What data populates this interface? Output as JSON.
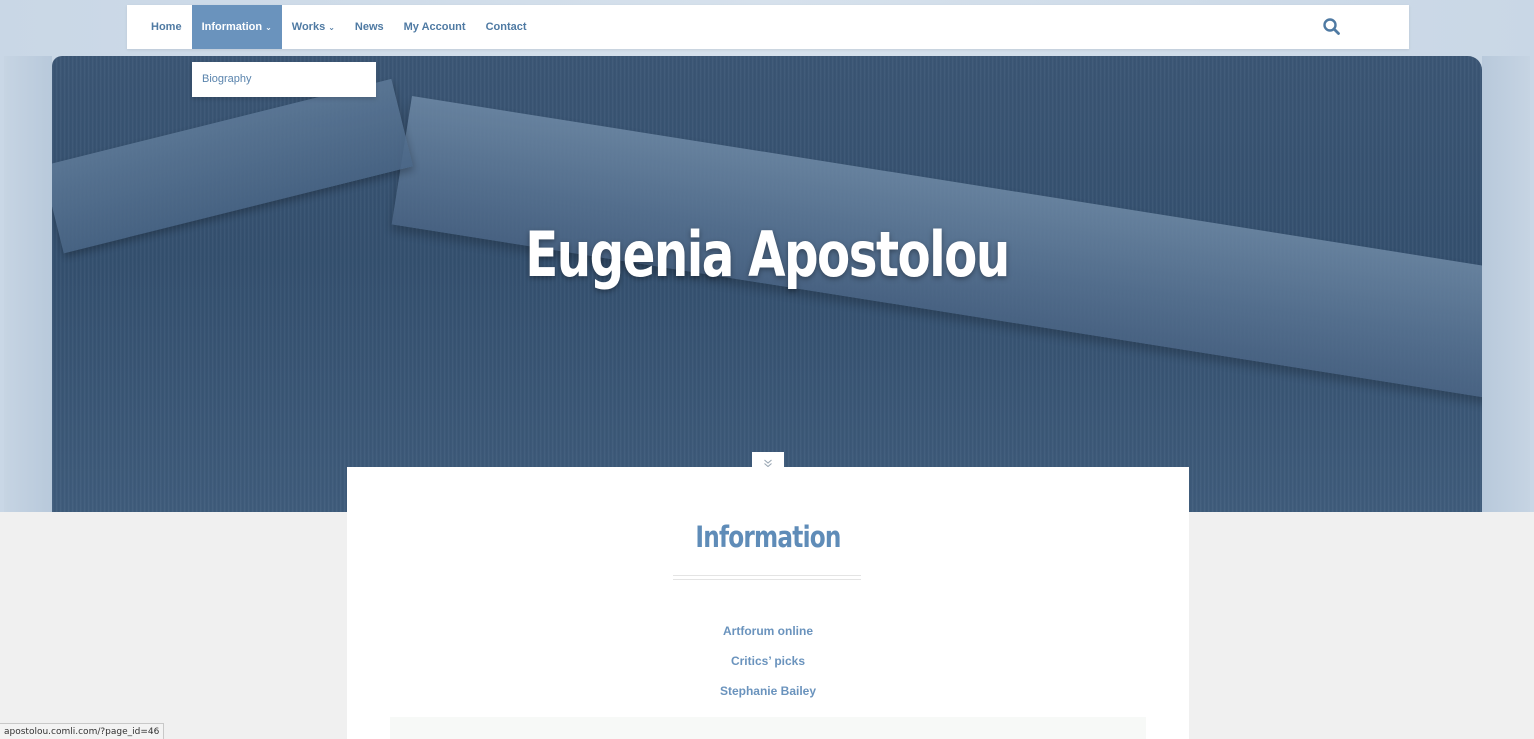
{
  "nav": {
    "items": [
      {
        "label": "Home",
        "has_dropdown": false,
        "active": false
      },
      {
        "label": "Information",
        "has_dropdown": true,
        "active": true
      },
      {
        "label": "Works",
        "has_dropdown": true,
        "active": false
      },
      {
        "label": "News",
        "has_dropdown": false,
        "active": false
      },
      {
        "label": "My Account",
        "has_dropdown": false,
        "active": false
      },
      {
        "label": "Contact",
        "has_dropdown": false,
        "active": false
      }
    ],
    "caret_glyph": "⌄",
    "search_icon": "search-icon",
    "active_color": "#6a93bd",
    "link_color": "#4f7aa3"
  },
  "dropdown": {
    "items": [
      {
        "label": "Biography"
      }
    ]
  },
  "hero": {
    "title": "Eugenia Apostolou"
  },
  "scroll_icon": "double-chevron-down-icon",
  "content": {
    "title": "Information",
    "links": [
      {
        "label": "Artforum online"
      },
      {
        "label": "Critics’ picks"
      },
      {
        "label": "Stephanie Bailey"
      }
    ],
    "accent_color": "#5f8cb8"
  },
  "status_bar": {
    "url": "apostolou.comli.com/?page_id=46"
  }
}
